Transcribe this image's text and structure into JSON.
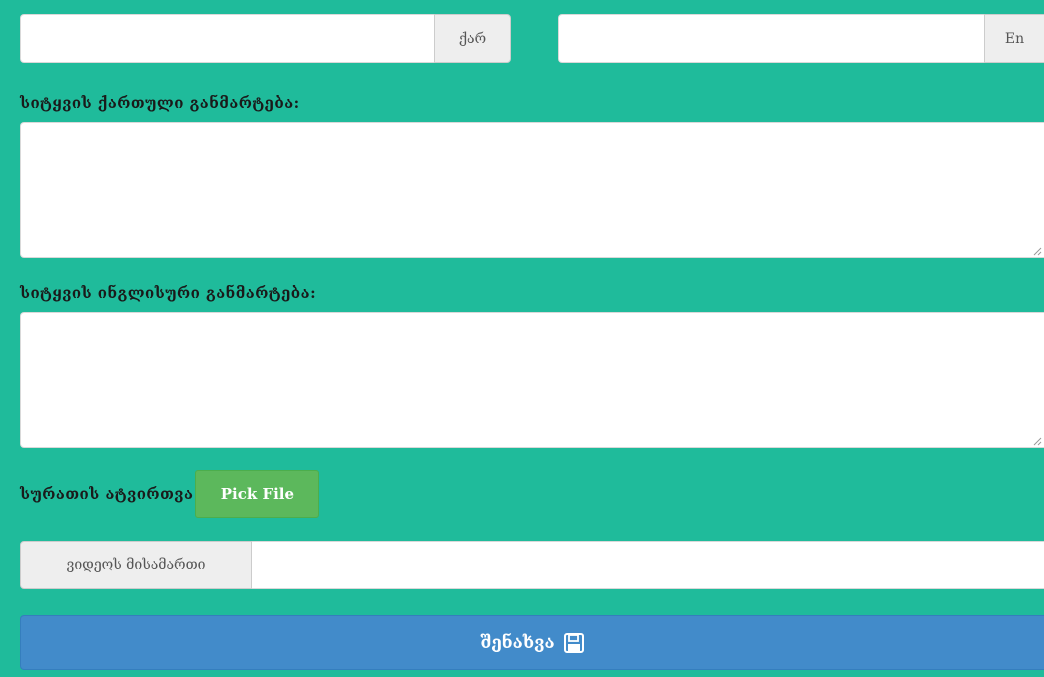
{
  "word_inputs": {
    "ka": {
      "value": "",
      "placeholder": "",
      "addon": "ქარ"
    },
    "en": {
      "value": "",
      "placeholder": "",
      "addon": "En"
    }
  },
  "definitions": {
    "georgian_label": "სიტყვის ქართული განმარტება:",
    "georgian_value": "",
    "english_label": "სიტყვის ინგლისური განმარტება:",
    "english_value": ""
  },
  "image_upload": {
    "label": "სურათის ატვირთვა",
    "button": "Pick File"
  },
  "video": {
    "addon": "ვიდეოს მისამართი",
    "value": "",
    "placeholder": ""
  },
  "save": {
    "label": "შენახვა",
    "icon": "floppy-disk-icon"
  },
  "colors": {
    "background": "#1fbb9b",
    "save_button": "#428bca",
    "pick_button": "#5cb85c",
    "addon_bg": "#eeeeee"
  }
}
